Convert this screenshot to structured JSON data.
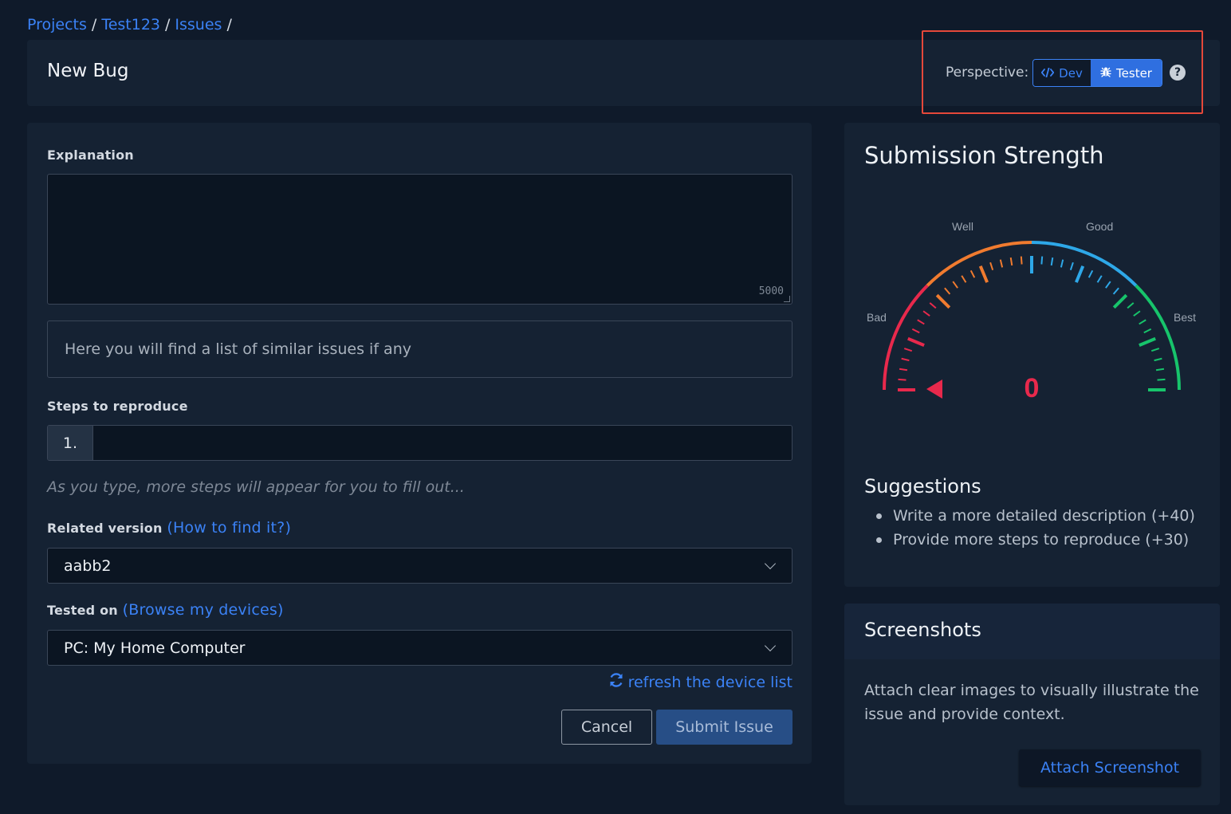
{
  "breadcrumb": {
    "items": [
      "Projects",
      "Test123",
      "Issues"
    ],
    "separator": "/"
  },
  "header": {
    "title": "New Bug",
    "perspective_label": "Perspective:",
    "dev_label": "Dev",
    "tester_label": "Tester",
    "active": "Tester",
    "help_icon": "question-circle-icon"
  },
  "form": {
    "explanation_label": "Explanation",
    "explanation_value": "",
    "char_count": "5000",
    "similar_placeholder": "Here you will find a list of similar issues if any",
    "steps_label": "Steps to reproduce",
    "step_number": "1.",
    "steps_hint": "As you type, more steps will appear for you to fill out...",
    "version_label": "Related version",
    "version_link": "(How to find it?)",
    "version_value": "aabb2",
    "tested_label": "Tested on",
    "tested_link": "(Browse my devices)",
    "tested_value": "PC: My Home Computer",
    "refresh_label": "refresh the device list",
    "cancel_label": "Cancel",
    "submit_label": "Submit Issue"
  },
  "strength": {
    "title": "Submission Strength",
    "gauge_labels": [
      "Bad",
      "Well",
      "Good",
      "Best"
    ],
    "score": "0",
    "suggestions_title": "Suggestions",
    "suggestions": [
      "Write a more detailed description (+40)",
      "Provide more steps to reproduce (+30)"
    ]
  },
  "screenshots": {
    "title": "Screenshots",
    "description": "Attach clear images to visually illustrate the issue and provide context.",
    "attach_label": "Attach Screenshot"
  },
  "colors": {
    "accent": "#3b82f6",
    "bad": "#e8294c",
    "well": "#f07b2f",
    "good": "#2ea8e8",
    "best": "#17c46b"
  }
}
